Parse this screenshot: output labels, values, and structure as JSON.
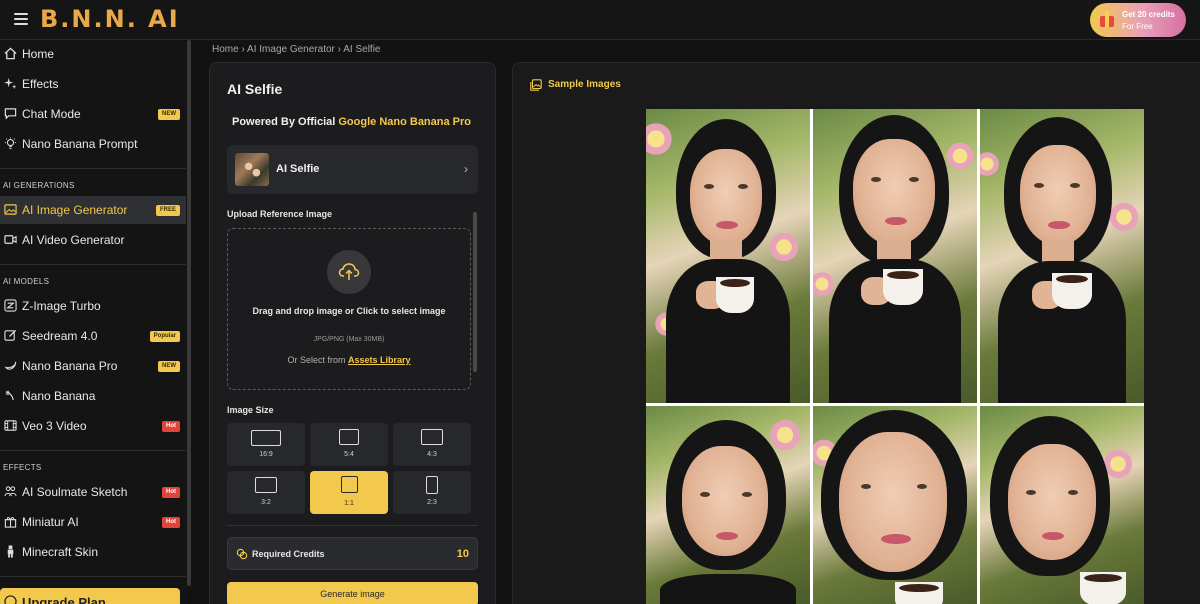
{
  "app": {
    "logo": "B.N.N. AI",
    "promo_line1": "Get 20 credits",
    "promo_line2": "For Free"
  },
  "sidebar": {
    "top_items": [
      {
        "label": "Home",
        "icon": "home-icon"
      },
      {
        "label": "Effects",
        "icon": "sparkles-icon"
      },
      {
        "label": "Chat Mode",
        "icon": "chat-icon",
        "badge": "NEW"
      },
      {
        "label": "Nano Banana Prompt",
        "icon": "bulb-icon"
      }
    ],
    "generations_heading": "AI GENERATIONS",
    "generations": [
      {
        "label": "AI Image Generator",
        "icon": "image-icon",
        "badge": "FREE",
        "active": true
      },
      {
        "label": "AI Video Generator",
        "icon": "video-icon"
      }
    ],
    "models_heading": "AI MODELS",
    "models": [
      {
        "label": "Z-Image Turbo",
        "icon": "z-icon"
      },
      {
        "label": "Seedream 4.0",
        "icon": "edit-icon",
        "badge": "Popular"
      },
      {
        "label": "Nano Banana Pro",
        "icon": "banana-icon",
        "badge": "NEW"
      },
      {
        "label": "Nano Banana",
        "icon": "banana-icon"
      },
      {
        "label": "Veo 3 Video",
        "icon": "film-icon",
        "badge": "Hot"
      }
    ],
    "effects_heading": "EFFECTS",
    "effects": [
      {
        "label": "AI Soulmate Sketch",
        "icon": "people-icon",
        "badge": "Hot"
      },
      {
        "label": "Miniatur AI",
        "icon": "gift-icon",
        "badge": "Hot"
      },
      {
        "label": "Minecraft Skin",
        "icon": "person-icon"
      }
    ],
    "upgrade_label": "Upgrade Plan"
  },
  "breadcrumb": {
    "home": "Home",
    "section": "AI Image Generator",
    "current": "AI Selfie",
    "separator": "›"
  },
  "panel": {
    "title": "AI Selfie",
    "powered_prefix": "Powered By Official",
    "powered_highlight": "Google Nano Banana Pro",
    "model_name": "AI Selfie",
    "upload_label": "Upload Reference Image",
    "dropzone_main": "Drag and drop image or Click to select image",
    "dropzone_formats": "JPG/PNG (Max 30MB)",
    "dropzone_or": "Or Select from",
    "dropzone_link": "Assets Library",
    "image_size_label": "Image Size",
    "sizes": [
      {
        "label": "16:9"
      },
      {
        "label": "5:4"
      },
      {
        "label": "4:3"
      },
      {
        "label": "3:2"
      },
      {
        "label": "1:1",
        "selected": true
      },
      {
        "label": "2:3"
      }
    ],
    "credits_label": "Required Credits",
    "credits_value": "10",
    "generate_label": "Generate image"
  },
  "samples": {
    "heading": "Sample Images"
  },
  "colors": {
    "accent": "#f2c94c",
    "hot": "#e0453a",
    "background": "#121212"
  }
}
